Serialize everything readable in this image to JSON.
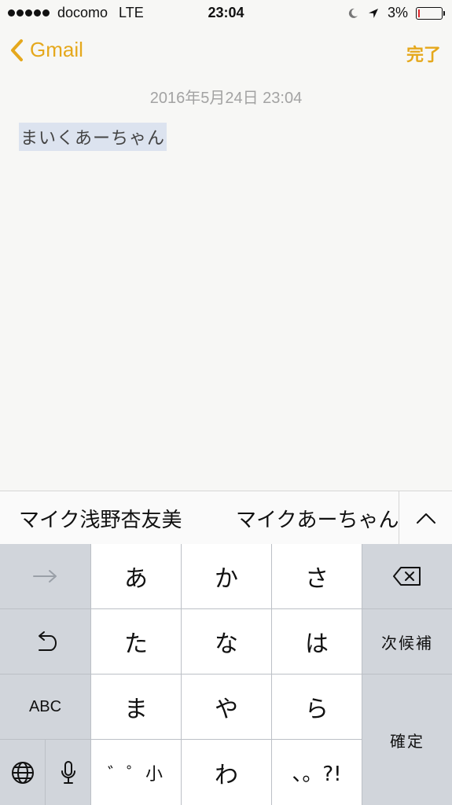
{
  "status_bar": {
    "carrier": "docomo",
    "network": "LTE",
    "time": "23:04",
    "battery": "3%",
    "battery_level": 0.03,
    "icons": [
      "signal-dots",
      "moon-icon",
      "location-arrow-icon",
      "battery-icon"
    ]
  },
  "nav": {
    "back_label": "Gmail",
    "done_label": "完了",
    "accent_color": "#e5a81c"
  },
  "note": {
    "timestamp": "2016年5月24日 23:04",
    "text": "まいくあーちゃん",
    "highlight_color": "#dce3ef"
  },
  "prediction": {
    "candidates": [
      "マイク浅野杏友美",
      "マイクあーちゃん"
    ]
  },
  "keyboard": {
    "keys": {
      "a": "あ",
      "ka": "か",
      "sa": "さ",
      "ta": "た",
      "na": "な",
      "ha": "は",
      "ma": "ま",
      "ya": "や",
      "ra": "ら",
      "dakuten": "゛゜小",
      "wa": "わ",
      "punct": "、。?!",
      "next_candidate": "次候補",
      "abc": "ABC",
      "confirm": "確定"
    }
  }
}
